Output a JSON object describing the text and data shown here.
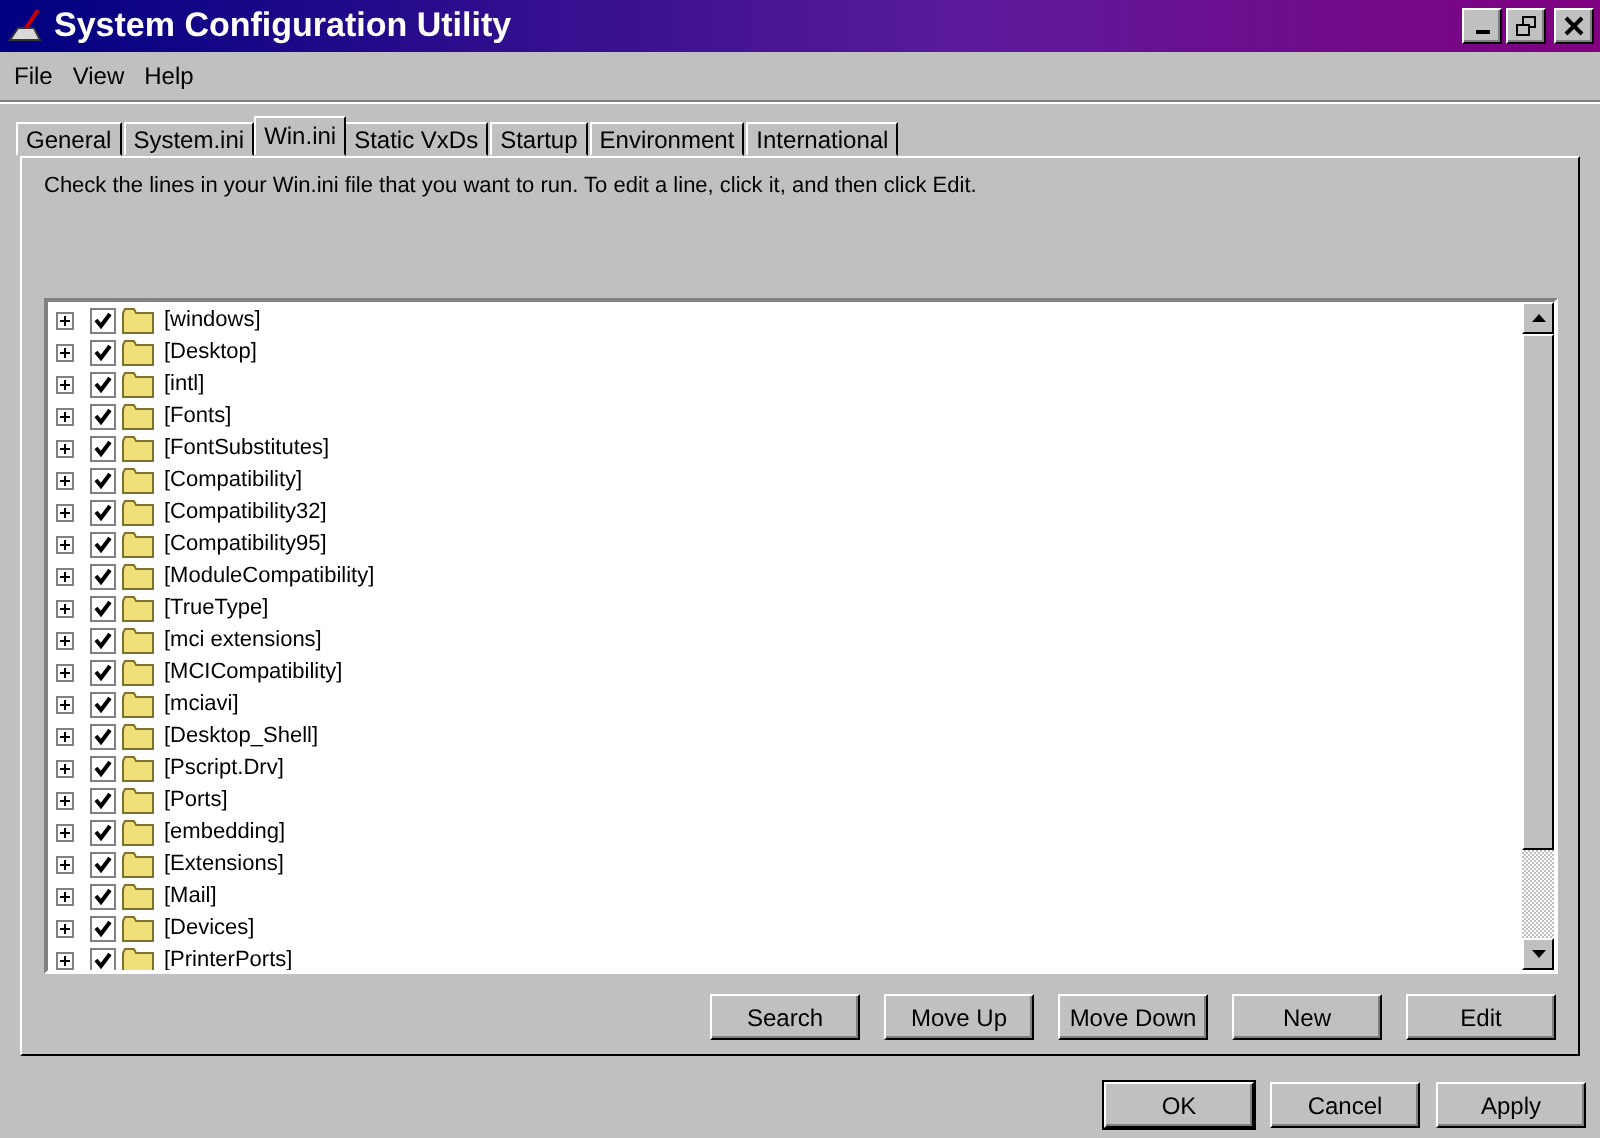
{
  "window": {
    "title": "System Configuration Utility"
  },
  "menu": [
    "File",
    "View",
    "Help"
  ],
  "tabs": [
    {
      "label": "General",
      "selected": false
    },
    {
      "label": "System.ini",
      "selected": false
    },
    {
      "label": "Win.ini",
      "selected": true
    },
    {
      "label": "Static VxDs",
      "selected": false
    },
    {
      "label": "Startup",
      "selected": false
    },
    {
      "label": "Environment",
      "selected": false
    },
    {
      "label": "International",
      "selected": false
    }
  ],
  "description": "Check the lines in your Win.ini file that you want to run. To edit a line, click it, and then click Edit.",
  "tree": [
    {
      "label": "[windows]",
      "checked": true,
      "expanded": false
    },
    {
      "label": "[Desktop]",
      "checked": true,
      "expanded": false
    },
    {
      "label": "[intl]",
      "checked": true,
      "expanded": false
    },
    {
      "label": "[Fonts]",
      "checked": true,
      "expanded": false
    },
    {
      "label": "[FontSubstitutes]",
      "checked": true,
      "expanded": false
    },
    {
      "label": "[Compatibility]",
      "checked": true,
      "expanded": false
    },
    {
      "label": "[Compatibility32]",
      "checked": true,
      "expanded": false
    },
    {
      "label": "[Compatibility95]",
      "checked": true,
      "expanded": false
    },
    {
      "label": "[ModuleCompatibility]",
      "checked": true,
      "expanded": false
    },
    {
      "label": "[TrueType]",
      "checked": true,
      "expanded": false
    },
    {
      "label": "[mci extensions]",
      "checked": true,
      "expanded": false
    },
    {
      "label": "[MCICompatibility]",
      "checked": true,
      "expanded": false
    },
    {
      "label": "[mciavi]",
      "checked": true,
      "expanded": false
    },
    {
      "label": "[Desktop_Shell]",
      "checked": true,
      "expanded": false
    },
    {
      "label": "[Pscript.Drv]",
      "checked": true,
      "expanded": false
    },
    {
      "label": "[Ports]",
      "checked": true,
      "expanded": false
    },
    {
      "label": "[embedding]",
      "checked": true,
      "expanded": false
    },
    {
      "label": "[Extensions]",
      "checked": true,
      "expanded": false
    },
    {
      "label": "[Mail]",
      "checked": true,
      "expanded": false
    },
    {
      "label": "[Devices]",
      "checked": true,
      "expanded": false
    },
    {
      "label": "[PrinterPorts]",
      "checked": true,
      "expanded": false
    }
  ],
  "tab_buttons": [
    "Search",
    "Move Up",
    "Move Down",
    "New",
    "Edit"
  ],
  "dialog_buttons": [
    {
      "label": "OK",
      "default": true
    },
    {
      "label": "Cancel",
      "default": false
    },
    {
      "label": "Apply",
      "default": false
    }
  ]
}
